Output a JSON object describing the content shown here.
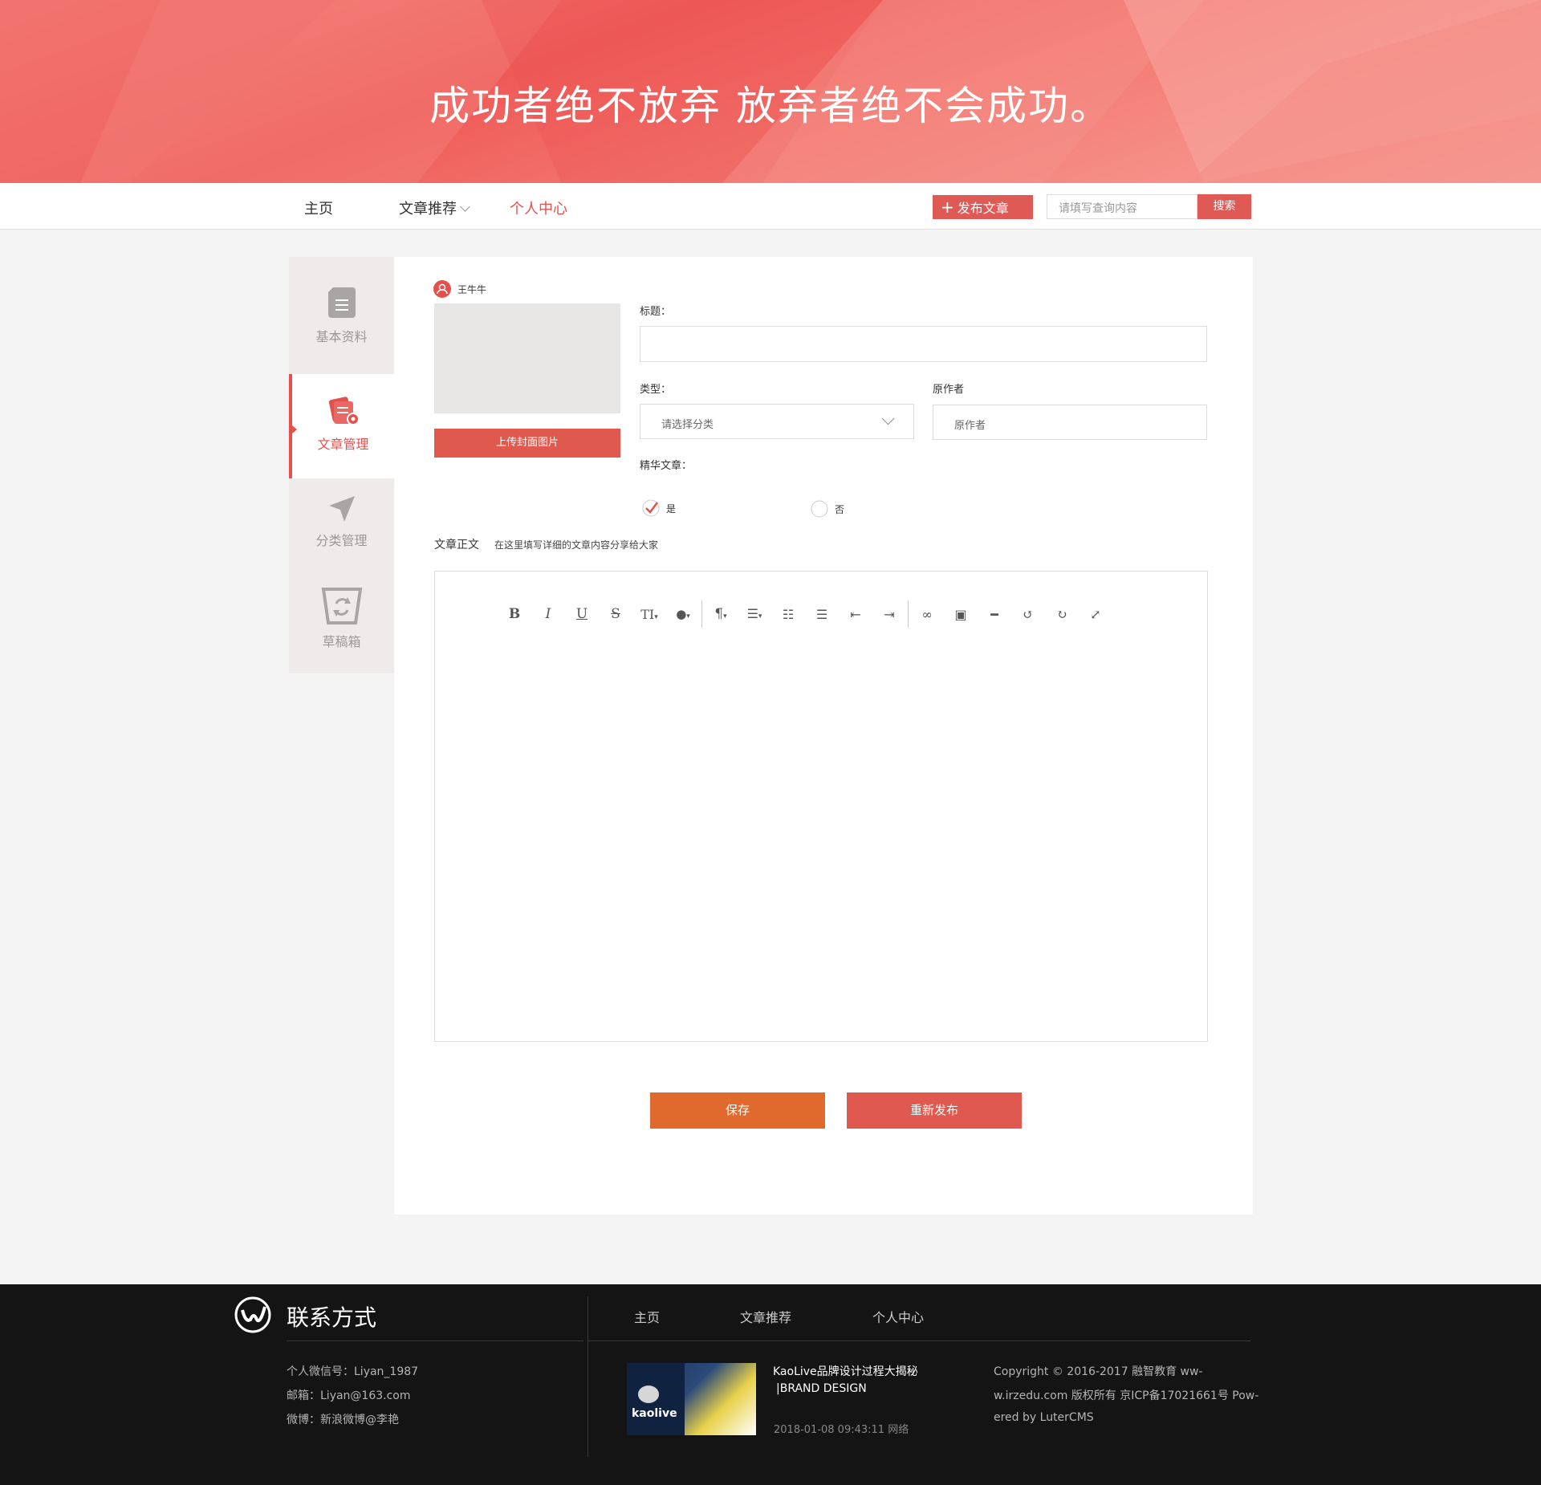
{
  "banner": {
    "title": "成功者绝不放弃    放弃者绝不会成功。"
  },
  "nav": {
    "home": "主页",
    "recommend": "文章推荐",
    "personal": "个人中心",
    "publish": "发布文章",
    "search_placeholder": "请填写查询内容",
    "search_button": "搜索"
  },
  "sidebar": {
    "items": [
      {
        "label": "基本资料",
        "icon": "document-icon"
      },
      {
        "label": "文章管理",
        "icon": "article-settings-icon"
      },
      {
        "label": "分类管理",
        "icon": "send-icon"
      },
      {
        "label": "草稿箱",
        "icon": "recycle-bin-icon"
      }
    ]
  },
  "form": {
    "author_name": "王牛牛",
    "upload_cover": "上传封面图片",
    "title_label": "标题：",
    "title_value": "",
    "type_label": "类型：",
    "type_placeholder": "请选择分类",
    "original_author_label": "原作者",
    "original_author_placeholder": "原作者",
    "featured_label": "精华文章：",
    "featured_yes": "是",
    "featured_no": "否",
    "featured_selected": "是",
    "body_label": "文章正文",
    "body_hint": "在这里填写详细的文章内容分享给大家",
    "save": "保存",
    "republish": "重新发布"
  },
  "toolbar": {
    "bold": "B",
    "italic": "I",
    "underline": "U",
    "strike": "S",
    "fontsize": "TI",
    "paragraph": "¶"
  },
  "footer": {
    "title": "联系方式",
    "wechat": "个人微信号：Liyan_1987",
    "email": "邮箱：Liyan@163.com",
    "weibo": "微博：新浪微博@李艳",
    "nav_home": "主页",
    "nav_recommend": "文章推荐",
    "nav_personal": "个人中心",
    "news_title_1": "KaoLive品牌设计过程大揭秘",
    "news_title_2": "|BRAND DESIGN",
    "news_meta": "2018-01-08 09:43:11 网络",
    "thumb_brand": "kaolive",
    "copyright_1": "Copyright © 2016-2017 融智教育 ww-",
    "copyright_2": "w.irzedu.com 版权所有 京ICP备17021661号 Pow-",
    "copyright_3": "ered by LuterCMS"
  },
  "colors": {
    "accent": "#e4514d",
    "save": "#e0692d",
    "footer_bg": "#141414"
  }
}
